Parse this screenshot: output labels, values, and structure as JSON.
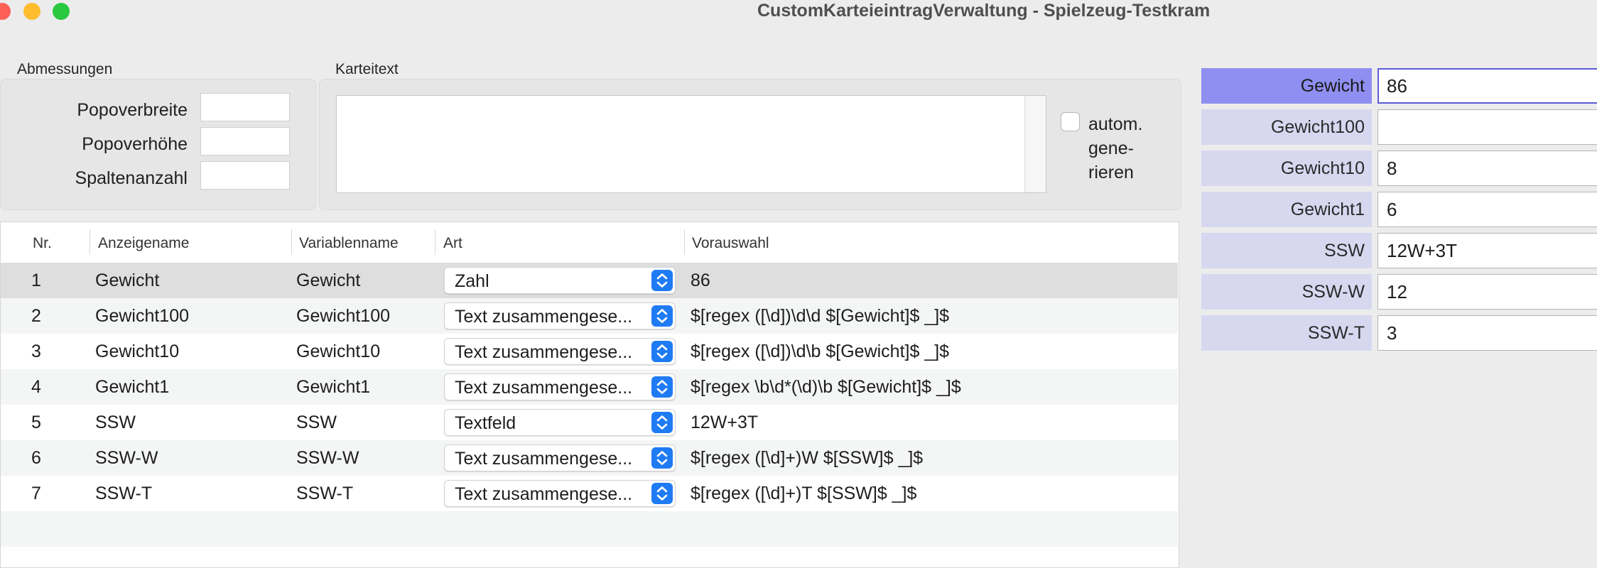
{
  "window": {
    "title": "CustomKarteieintragVerwaltung - Spielzeug-Testkram"
  },
  "dimensions": {
    "group_label": "Abmessungen",
    "fields": [
      {
        "label": "Popoverbreite",
        "value": ""
      },
      {
        "label": "Popoverhöhe",
        "value": ""
      },
      {
        "label": "Spaltenanzahl",
        "value": ""
      }
    ]
  },
  "karteitext": {
    "group_label": "Karteitext",
    "value": "",
    "auto_generate_label": "autom.\ngene-\nrieren",
    "auto_generate_checked": false
  },
  "table": {
    "headers": [
      "Nr.",
      "Anzeigename",
      "Variablenname",
      "Art",
      "Vorauswahl"
    ],
    "rows": [
      {
        "nr": "1",
        "anzeigename": "Gewicht",
        "variablenname": "Gewicht",
        "art": "Zahl",
        "vorauswahl": "86"
      },
      {
        "nr": "2",
        "anzeigename": "Gewicht100",
        "variablenname": "Gewicht100",
        "art": "Text zusammengese...",
        "vorauswahl": "$[regex ([\\d])\\d\\d $[Gewicht]$ _]$"
      },
      {
        "nr": "3",
        "anzeigename": "Gewicht10",
        "variablenname": "Gewicht10",
        "art": "Text zusammengese...",
        "vorauswahl": "$[regex ([\\d])\\d\\b $[Gewicht]$ _]$"
      },
      {
        "nr": "4",
        "anzeigename": "Gewicht1",
        "variablenname": "Gewicht1",
        "art": "Text zusammengese...",
        "vorauswahl": "$[regex \\b\\d*(\\d)\\b $[Gewicht]$ _]$"
      },
      {
        "nr": "5",
        "anzeigename": "SSW",
        "variablenname": "SSW",
        "art": "Textfeld",
        "vorauswahl": "12W+3T"
      },
      {
        "nr": "6",
        "anzeigename": "SSW-W",
        "variablenname": "SSW-W",
        "art": "Text zusammengese...",
        "vorauswahl": "$[regex ([\\d]+)W $[SSW]$ _]$"
      },
      {
        "nr": "7",
        "anzeigename": "SSW-T",
        "variablenname": "SSW-T",
        "art": "Text zusammengese...",
        "vorauswahl": "$[regex ([\\d]+)T $[SSW]$ _]$"
      }
    ]
  },
  "preview": {
    "items": [
      {
        "label": "Gewicht",
        "value": "86"
      },
      {
        "label": "Gewicht100",
        "value": ""
      },
      {
        "label": "Gewicht10",
        "value": "8"
      },
      {
        "label": "Gewicht1",
        "value": "6"
      },
      {
        "label": "SSW",
        "value": "12W+3T"
      },
      {
        "label": "SSW-W",
        "value": "12"
      },
      {
        "label": "SSW-T",
        "value": "3"
      }
    ]
  },
  "colors": {
    "selection_accent": "#8e8ff0",
    "label_background": "#d7d8f0",
    "popup_stepper": "#1f7bf3"
  }
}
